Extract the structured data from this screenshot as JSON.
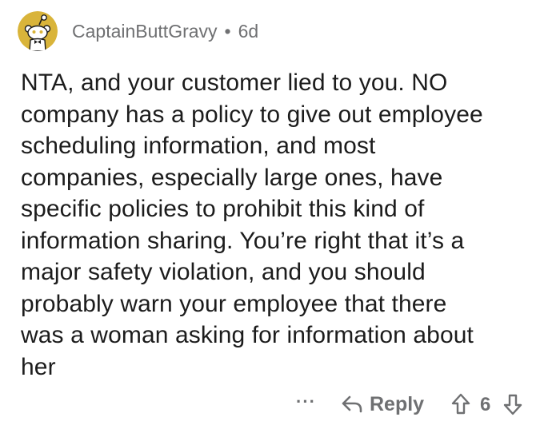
{
  "comment": {
    "author": "CaptainButtGravy",
    "separator": "•",
    "age": "6d",
    "avatar_icon": "snoo-avatar-icon",
    "avatar_color": "#d9b43a",
    "body_lines": [
      "NTA, and your customer lied to you. NO",
      "company has a policy to give out employee",
      "scheduling information, and most",
      "companies, especially large ones, have",
      "specific policies to prohibit this kind of",
      "information sharing. You’re right that it’s a",
      "major safety violation, and you should",
      "probably warn your employee that there",
      "was a woman asking for information about",
      "her"
    ]
  },
  "actions": {
    "more_label": "···",
    "reply_label": "Reply",
    "reply_icon": "reply-arrow-icon",
    "upvote_icon": "upvote-arrow-icon",
    "score": "6",
    "downvote_icon": "downvote-arrow-icon"
  }
}
